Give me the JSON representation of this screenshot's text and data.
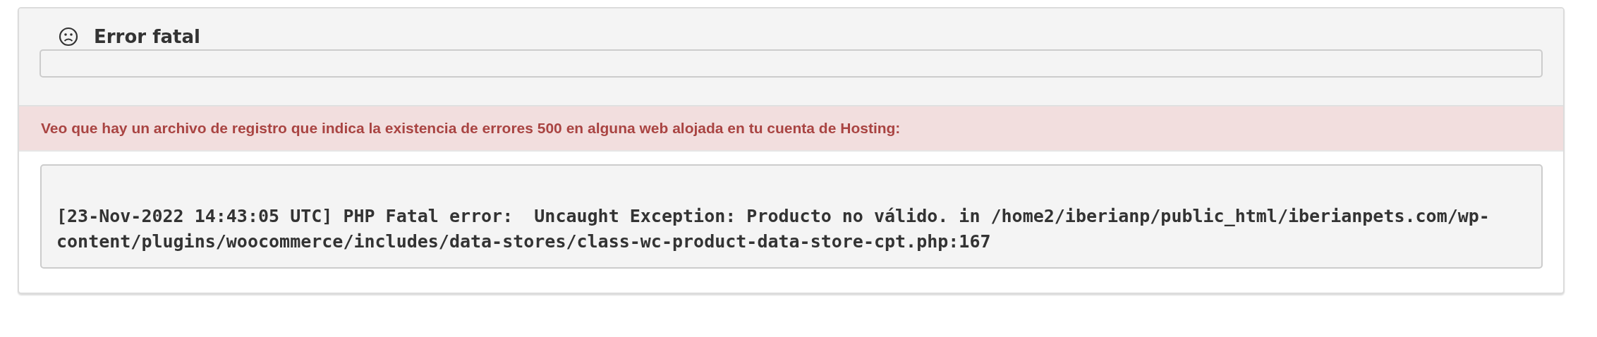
{
  "panel": {
    "title": "Error fatal",
    "alert": "Veo que hay un archivo de registro que indica la existencia de errores 500 en alguna web alojada en tu cuenta de Hosting:",
    "log": "[23-Nov-2022 14:43:05 UTC] PHP Fatal error:  Uncaught Exception: Producto no válido. in /home2/iberianp/public_html/iberianpets.com/wp-content/plugins/woocommerce/includes/data-stores/class-wc-product-data-store-cpt.php:167"
  }
}
